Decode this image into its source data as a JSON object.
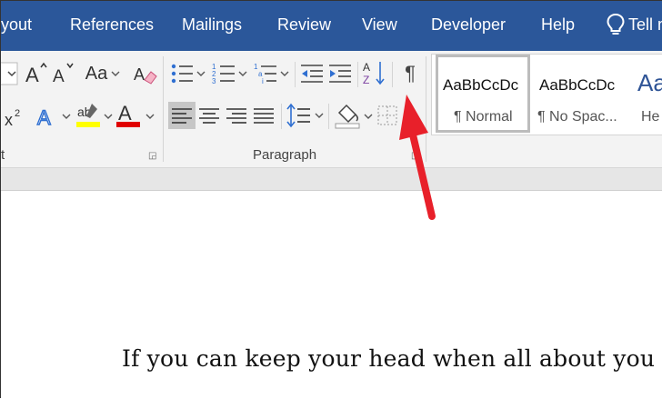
{
  "tabs": [
    {
      "label": "yout"
    },
    {
      "label": "References"
    },
    {
      "label": "Mailings"
    },
    {
      "label": "Review"
    },
    {
      "label": "View"
    },
    {
      "label": "Developer"
    },
    {
      "label": "Help"
    }
  ],
  "tell_me": {
    "label": "Tell m"
  },
  "ribbon": {
    "font_group_label": "t",
    "paragraph_group_label": "Paragraph",
    "change_case_label": "Aa",
    "highlight_label": "ab",
    "font_color_label": "A",
    "pilcrow": "¶",
    "sort_label_top": "A",
    "sort_label_bottom": "Z"
  },
  "styles": [
    {
      "sample": "AaBbCcDc",
      "name": "¶ Normal"
    },
    {
      "sample": "AaBbCcDc",
      "name": "¶ No Spac..."
    },
    {
      "sample": "Aa",
      "name": "He"
    }
  ],
  "document": {
    "line": "If you can keep your head when all about you"
  },
  "colors": {
    "tab_bar": "#2b579a",
    "ribbon_bg": "#f3f3f3",
    "highlight_yellow": "#ffff00",
    "font_red": "#e00000",
    "arrow_red": "#e8202a"
  }
}
